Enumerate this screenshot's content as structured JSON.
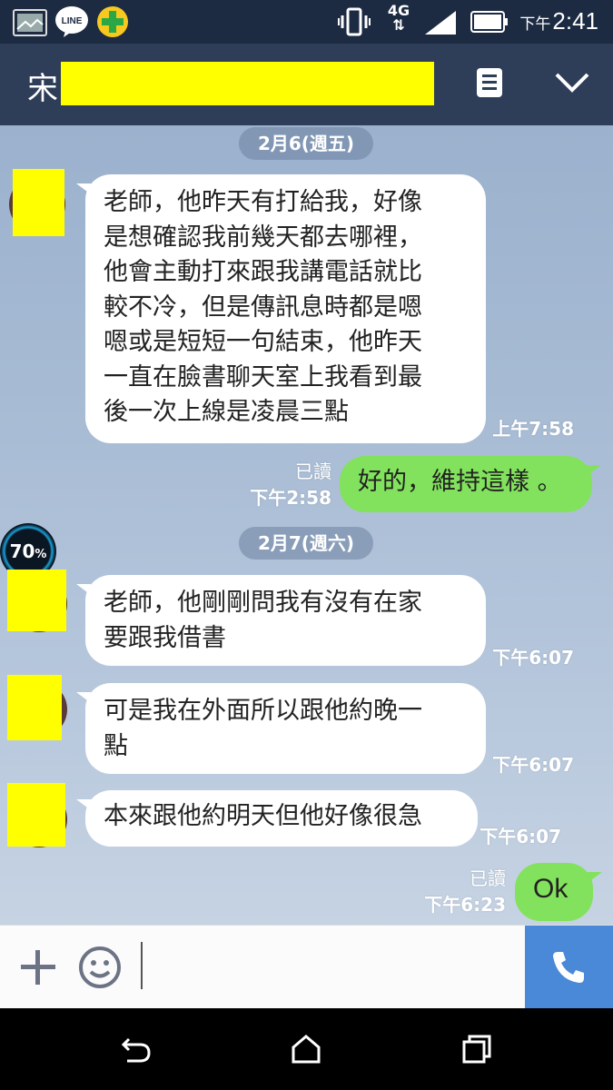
{
  "status_bar": {
    "time_prefix": "下午",
    "time": "2:41",
    "network": "4G",
    "app_icons": [
      "gallery-icon",
      "line-app-icon",
      "plus-app-icon"
    ]
  },
  "header": {
    "contact_name": "宋",
    "icons": [
      "notes-icon",
      "chevron-down-icon"
    ]
  },
  "chat": {
    "dates": [
      "2月6(週五)",
      "2月7(週六)"
    ],
    "messages": [
      {
        "side": "left",
        "lines": [
          "老師，他昨天有打給我，好像",
          "是想確認我前幾天都去哪裡，",
          "他會主動打來跟我講電話就比",
          "較不冷，但是傳訊息時都是嗯",
          "嗯或是短短一句結束，他昨天",
          "一直在臉書聊天室上我看到最",
          "後一次上線是凌晨三點"
        ],
        "time": "上午7:58"
      },
      {
        "side": "right",
        "lines": [
          "好的，維持這樣 。"
        ],
        "read": "已讀",
        "time": "下午2:58"
      },
      {
        "side": "left",
        "lines": [
          "老師，他剛剛問我有沒有在家",
          "要跟我借書"
        ],
        "time": "下午6:07"
      },
      {
        "side": "left",
        "lines": [
          "可是我在外面所以跟他約晚一",
          "點"
        ],
        "time": "下午6:07"
      },
      {
        "side": "left",
        "lines": [
          "本來跟他約明天但他好像很急"
        ],
        "time": "下午6:07"
      },
      {
        "side": "right",
        "lines": [
          "Ok"
        ],
        "read": "已讀",
        "time": "下午6:23"
      }
    ],
    "widget_percent": "70",
    "widget_unit": "%"
  },
  "input_bar": {
    "placeholder": "",
    "icons": [
      "plus-icon",
      "emoji-icon",
      "phone-call-icon"
    ]
  },
  "nav": {
    "icons": [
      "back-icon",
      "home-icon",
      "recents-icon"
    ]
  },
  "colors": {
    "header_bg": "#2e3d58",
    "status_bg": "#1c2a42",
    "my_bubble": "#82e25d",
    "call_button": "#4a88d8",
    "redaction": "#ffff00"
  }
}
